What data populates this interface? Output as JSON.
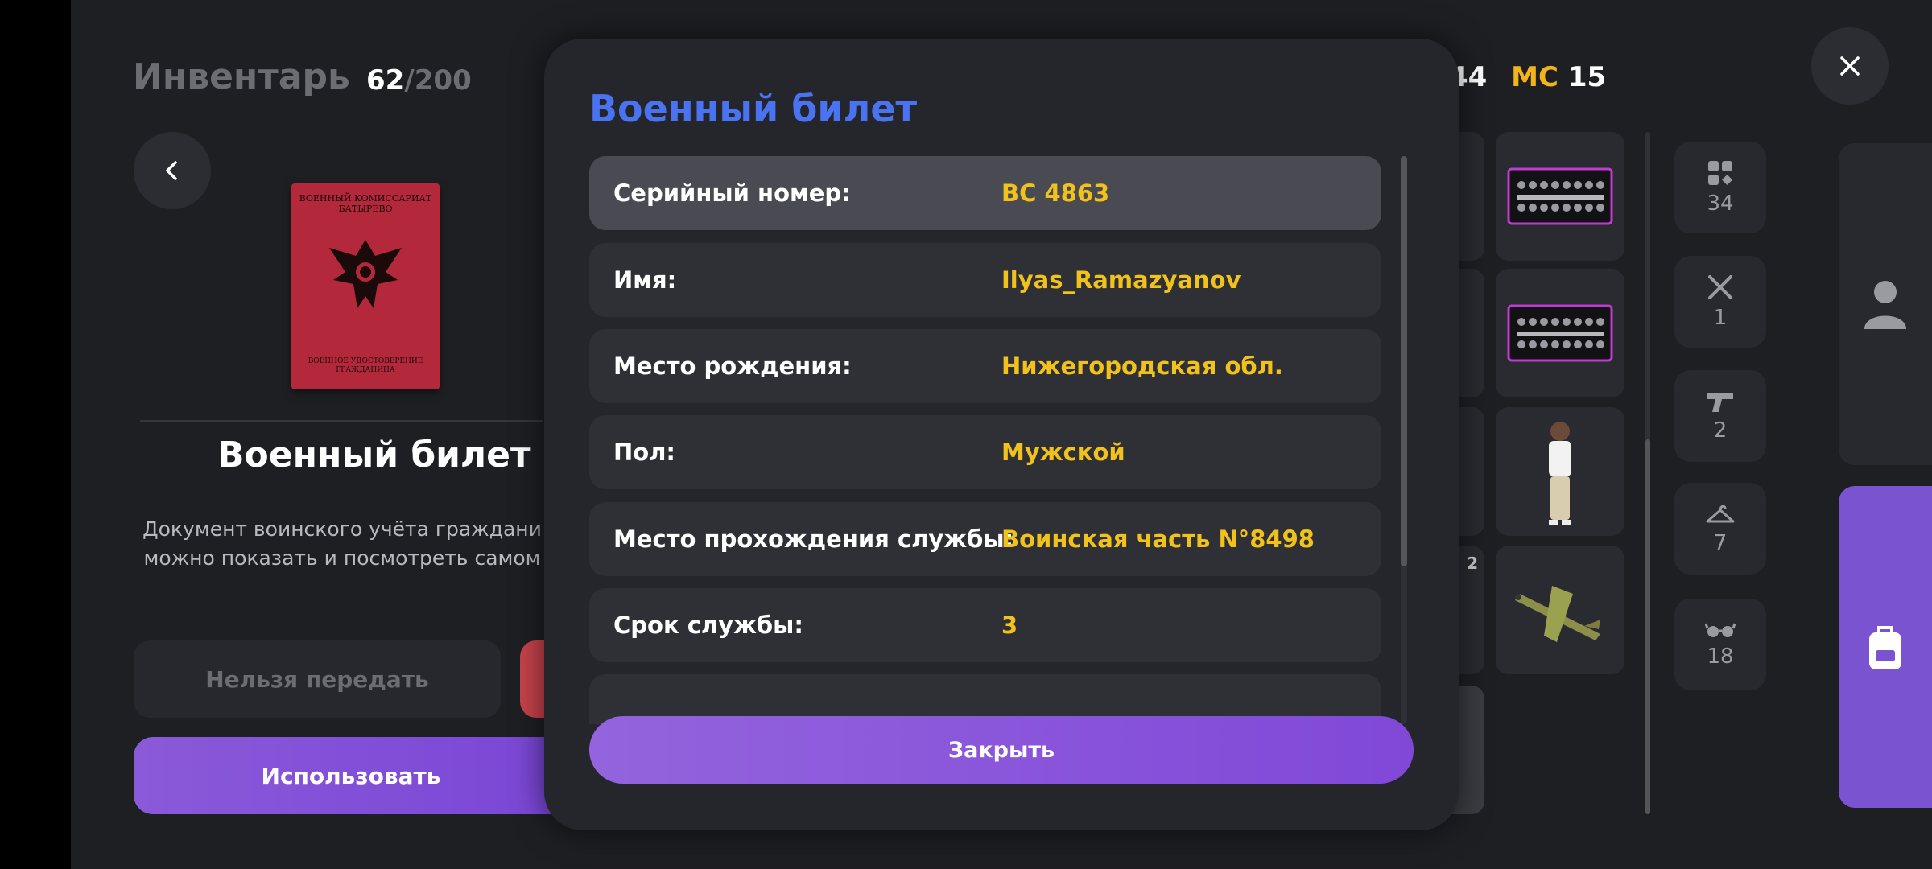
{
  "inventory": {
    "title": "Инвентарь",
    "count": "62",
    "separator": "/",
    "max": "200"
  },
  "item": {
    "booklet_top": "ВОЕННЫЙ КОМИССАРИАТ БАТЫРЕВО",
    "booklet_bottom": "ВОЕННОЕ УДОСТОВЕРЕНИЕ ГРАЖДАНИНА",
    "title": "Военный билет",
    "desc_line1": "Документ воинского учёта граждани",
    "desc_line2": "можно показать и посмотреть самом",
    "no_transfer": "Нельзя передать",
    "use": "Использовать"
  },
  "header_right": {
    "partial_value": "44",
    "mc_label": "MC",
    "mc_value": "15"
  },
  "grid": {
    "cell_qty": "2"
  },
  "categories": [
    {
      "icon": "grid-icon",
      "count": "34"
    },
    {
      "icon": "fork-knife-icon",
      "count": "1"
    },
    {
      "icon": "pistol-icon",
      "count": "2"
    },
    {
      "icon": "hanger-icon",
      "count": "7"
    },
    {
      "icon": "glasses-icon",
      "count": "18"
    }
  ],
  "modal": {
    "title": "Военный билет",
    "rows": [
      {
        "label": "Серийный номер:",
        "value": "BC 4863"
      },
      {
        "label": "Имя:",
        "value": "Ilyas_Ramazyanov"
      },
      {
        "label": "Место рождения:",
        "value": "Нижегородская обл."
      },
      {
        "label": "Пол:",
        "value": "Мужской"
      },
      {
        "label": "Место прохождения службы:",
        "value": "Воинская часть N°8498"
      },
      {
        "label": "Срок службы:",
        "value": "3"
      }
    ],
    "close": "Закрыть"
  },
  "colors": {
    "accent_blue": "#4a73f2",
    "value_yellow": "#f2c21c",
    "purple": "#8a5ad9"
  }
}
